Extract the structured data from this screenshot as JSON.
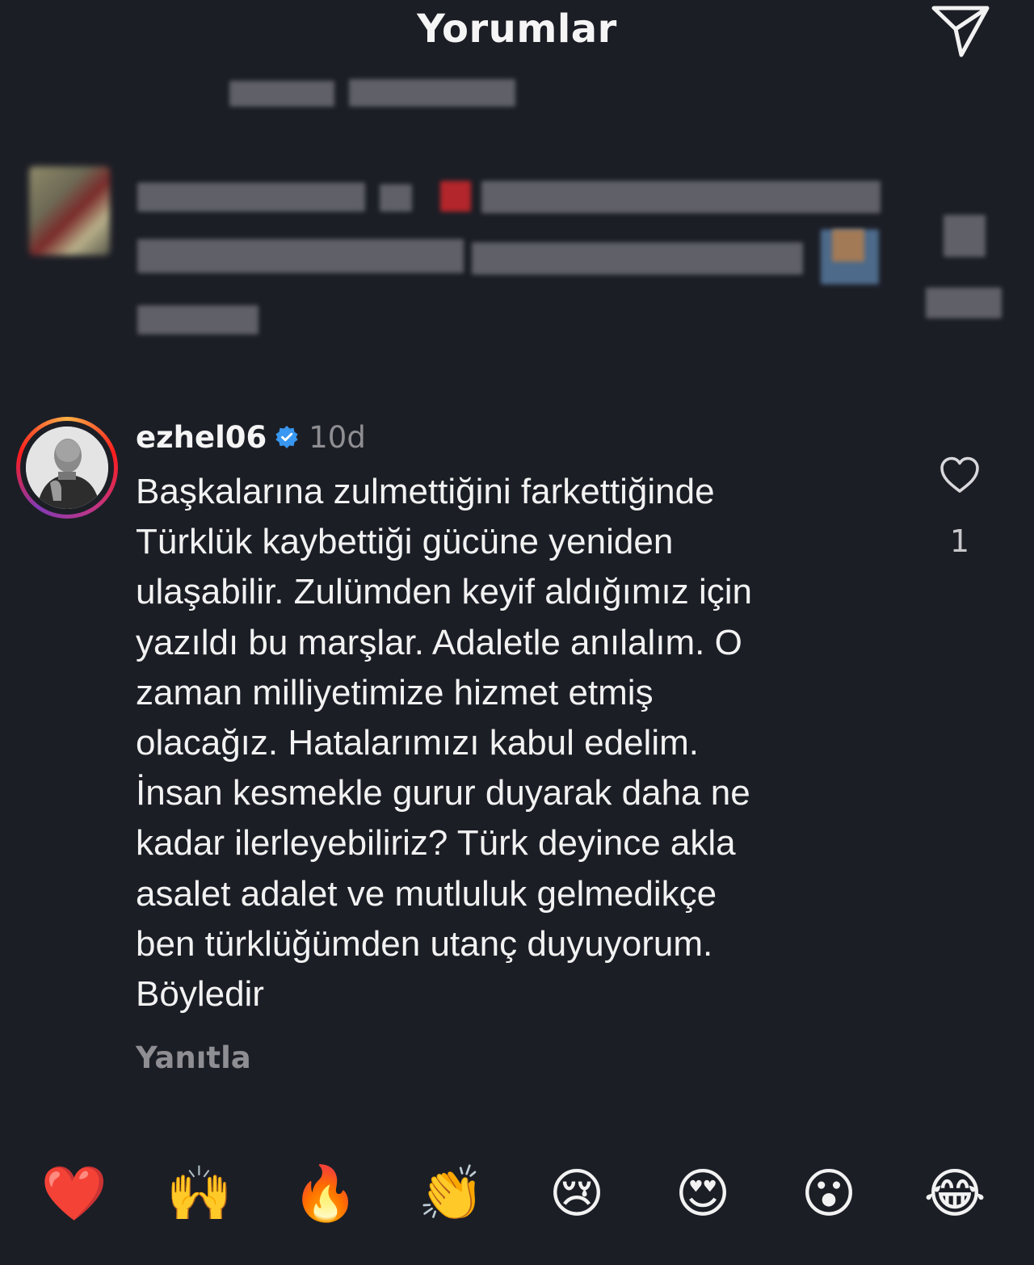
{
  "header": {
    "title": "Yorumlar",
    "send_icon": "paper-plane-icon"
  },
  "comment": {
    "username": "ezhel06",
    "verified": true,
    "time": "10d",
    "text": "Başkalarına zulmettiğini farkettiğinde\nTürklük kaybettiği gücüne yeniden\nulaşabilir. Zulümden keyif aldığımız için\nyazıldı bu marşlar. Adaletle anılalım. O\nzaman milliyetimize hizmet etmiş\nolacağız. Hatalarımızı kabul edelim.\nİnsan kesmekle gurur duyarak daha ne\nkadar ilerleyebiliriz? Türk deyince akla\nasalet adalet ve mutluluk gelmedikçe\nben türklüğümden utanç duyuyorum.\nBöyledir",
    "reply_label": "Yanıtla",
    "like_count": "1",
    "like_icon": "heart-outline-icon"
  },
  "emoji_bar": {
    "emojis": [
      "❤️",
      "🙌",
      "🔥",
      "👏",
      "😢",
      "😍",
      "😮",
      "😂"
    ]
  },
  "colors": {
    "background": "#1c1e26",
    "verified_blue": "#3897f0",
    "muted_text": "#8e8e93"
  }
}
